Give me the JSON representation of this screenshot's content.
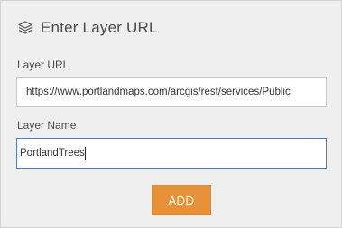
{
  "panel": {
    "title": "Enter Layer URL",
    "icon": "layers-icon"
  },
  "fields": {
    "url": {
      "label": "Layer URL",
      "value": "https://www.portlandmaps.com/arcgis/rest/services/Public"
    },
    "name": {
      "label": "Layer Name",
      "value": "PortlandTrees"
    }
  },
  "actions": {
    "add_label": "ADD"
  },
  "colors": {
    "panel_bg": "#efefef",
    "accent_button": "#e7913a",
    "focus_border": "#4f7fbf"
  }
}
